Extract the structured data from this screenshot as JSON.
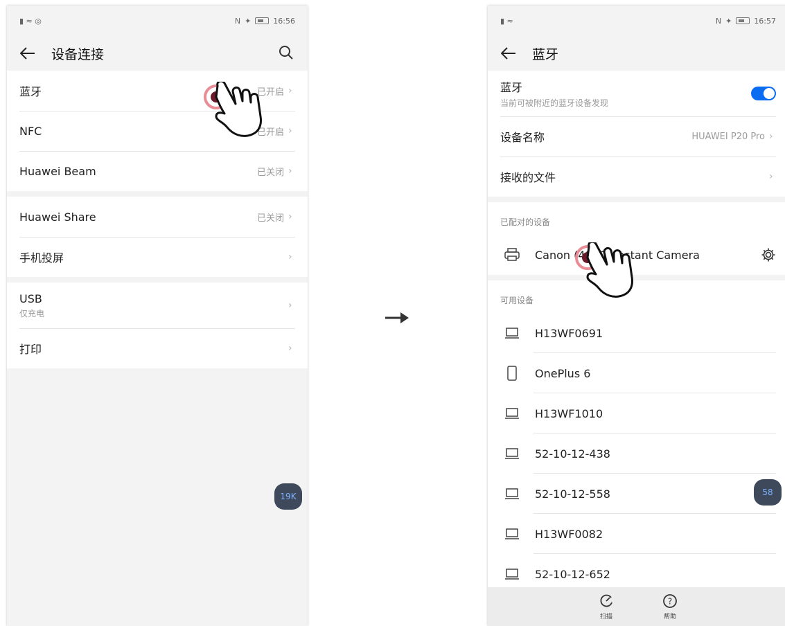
{
  "left": {
    "status_time": "16:56",
    "title": "设备连接",
    "items": [
      {
        "label": "蓝牙",
        "value": "已开启"
      },
      {
        "label": "NFC",
        "value": "已开启"
      },
      {
        "label": "Huawei Beam",
        "value": "已关闭"
      },
      {
        "label": "Huawei Share",
        "value": "已关闭"
      },
      {
        "label": "手机投屏",
        "value": ""
      },
      {
        "label": "USB",
        "sub": "仅充电",
        "value": ""
      },
      {
        "label": "打印",
        "value": ""
      }
    ],
    "float_text": "19K"
  },
  "right": {
    "status_time": "16:57",
    "title": "蓝牙",
    "bluetooth": {
      "label": "蓝牙",
      "sub": "当前可被附近的蓝牙设备发现",
      "on": true
    },
    "device_name": {
      "label": "设备名称",
      "value": "HUAWEI P20 Pro"
    },
    "received_files": {
      "label": "接收的文件"
    },
    "paired_title": "已配对的设备",
    "paired": [
      {
        "label": "Canon (4810) Instant Camera",
        "icon": "printer-icon"
      }
    ],
    "available_title": "可用设备",
    "available": [
      {
        "label": "H13WF0691",
        "icon": "laptop-icon"
      },
      {
        "label": "OnePlus 6",
        "icon": "phone-icon"
      },
      {
        "label": "H13WF1010",
        "icon": "laptop-icon"
      },
      {
        "label": "52-10-12-438",
        "icon": "laptop-icon"
      },
      {
        "label": "52-10-12-558",
        "icon": "laptop-icon"
      },
      {
        "label": "H13WF0082",
        "icon": "laptop-icon"
      },
      {
        "label": "52-10-12-652",
        "icon": "laptop-icon"
      }
    ],
    "bottom": {
      "scan": "扫描",
      "help": "帮助"
    },
    "float_text": "58"
  },
  "colors": {
    "accent": "#0a6cf0",
    "tap_ring": "#e88c96",
    "background": "#f3f3f3"
  }
}
